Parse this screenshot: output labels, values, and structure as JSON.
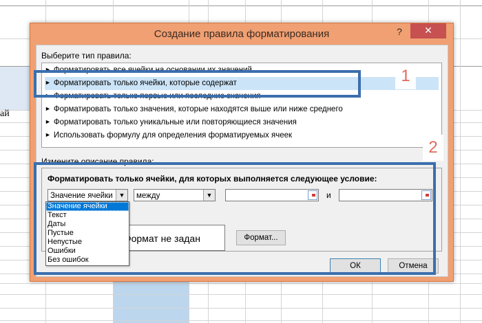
{
  "sheet": {
    "cell_text": "ай"
  },
  "dialog": {
    "title": "Создание правила форматирования",
    "help_label": "?",
    "close_label": "✕",
    "rule_type_label": "Выберите тип правила:",
    "rule_types": [
      "Форматировать все ячейки на основании их значений",
      "Форматировать только ячейки, которые содержат",
      "Форматировать только первые или последние значения",
      "Форматировать только значения, которые находятся выше или ниже среднего",
      "Форматировать только уникальные или повторяющиеся значения",
      "Использовать формулу для определения форматируемых ячеек"
    ],
    "rule_arrow": "►",
    "description_label": "Измените описание правила:",
    "condition_title": "Форматировать только ячейки, для которых выполняется следующее условие:",
    "cell_value_combo": "Значение ячейки",
    "operator_combo": "между",
    "and_label": "и",
    "dropdown_items": [
      "Значение ячейки",
      "Текст",
      "Даты",
      "Пустые",
      "Непустые",
      "Ошибки",
      "Без ошибок"
    ],
    "preview_text": "Формат не задан",
    "format_button": "Формат...",
    "ok_button": "ОК",
    "cancel_button": "Отмена"
  },
  "annotations": {
    "label_1": "1",
    "label_2": "2"
  },
  "colors": {
    "accent": "#f0a073",
    "annotation": "#3b6fae",
    "annotation_number": "#e06a5a",
    "selection": "#0078d7"
  }
}
